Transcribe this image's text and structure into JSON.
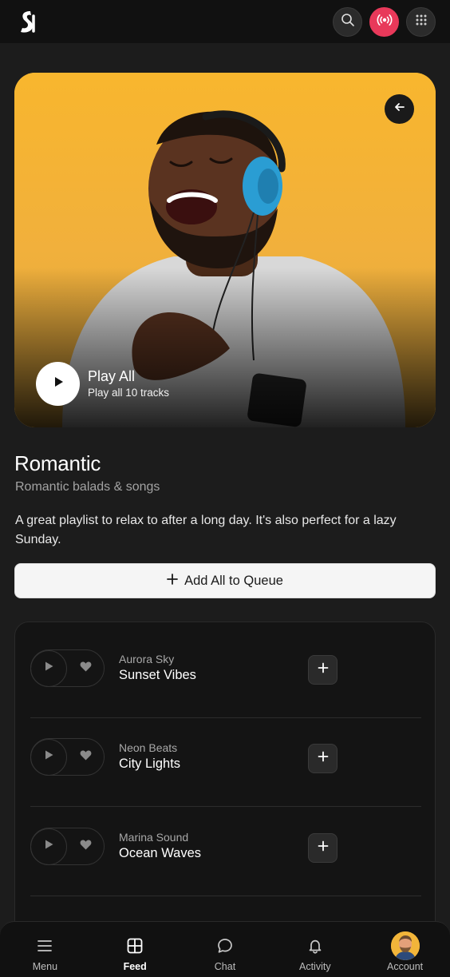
{
  "header": {
    "logo_icon": "s-logo-icon",
    "actions": [
      {
        "icon": "search-icon"
      },
      {
        "icon": "broadcast-icon",
        "color": "#e8395a"
      },
      {
        "icon": "grid-icon"
      }
    ]
  },
  "hero": {
    "back_icon": "arrow-left-icon",
    "play_title": "Play All",
    "play_subtitle": "Play all 10 tracks",
    "accent": "#f7b733"
  },
  "playlist": {
    "title": "Romantic",
    "subtitle": "Romantic balads & songs",
    "description": "A great playlist to relax to after a long day. It's also perfect for a lazy Sunday.",
    "queue_label": "Add All to Queue"
  },
  "tracks": [
    {
      "artist": "Aurora Sky",
      "name": "Sunset Vibes"
    },
    {
      "artist": "Neon Beats",
      "name": "City Lights"
    },
    {
      "artist": "Marina Sound",
      "name": "Ocean Waves"
    },
    {
      "artist": "",
      "name": ""
    }
  ],
  "nav": {
    "items": [
      {
        "label": "Menu",
        "icon": "menu-icon"
      },
      {
        "label": "Feed",
        "icon": "grid-square-icon",
        "active": true
      },
      {
        "label": "Chat",
        "icon": "chat-bubble-icon"
      },
      {
        "label": "Activity",
        "icon": "bell-icon"
      },
      {
        "label": "Account",
        "icon": "avatar"
      }
    ]
  }
}
